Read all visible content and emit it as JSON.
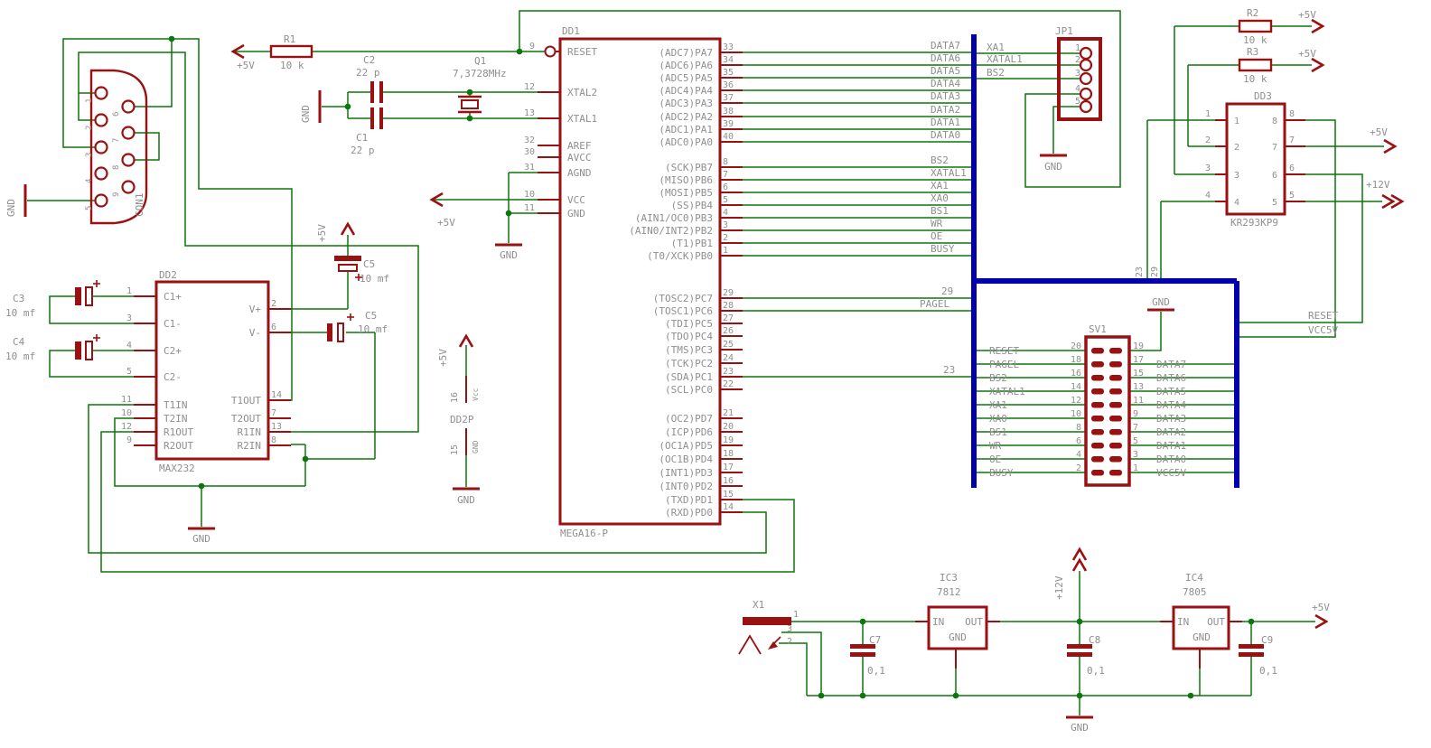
{
  "power": {
    "p5v": "+5V",
    "p12v": "+12V",
    "gnd": "GND"
  },
  "nets": {
    "reset": "RESET",
    "vcc5v": "VCC5V",
    "pagel": "PAGEL",
    "n23": "23",
    "n29": "29"
  },
  "components": {
    "con1": {
      "ref": "CON1",
      "pins_left": [
        "1",
        "2",
        "3",
        "4",
        "5"
      ],
      "pins_right": [
        "6",
        "7",
        "8",
        "9"
      ]
    },
    "r1": {
      "ref": "R1",
      "value": "10 k"
    },
    "r2": {
      "ref": "R2",
      "value": "10 k"
    },
    "r3": {
      "ref": "R3",
      "value": "10 k"
    },
    "c1": {
      "ref": "C1",
      "value": "22 p"
    },
    "c2": {
      "ref": "C2",
      "value": "22 p"
    },
    "c3": {
      "ref": "C3",
      "value": "10 mf"
    },
    "c4": {
      "ref": "C4",
      "value": "10 mf"
    },
    "c5a": {
      "ref": "C5",
      "value": "10 mf"
    },
    "c5b": {
      "ref": "C5",
      "value": "10 mf"
    },
    "c7": {
      "ref": "C7",
      "value": "0,1"
    },
    "c8": {
      "ref": "C8",
      "value": "0,1"
    },
    "c9": {
      "ref": "C9",
      "value": "0,1"
    },
    "q1": {
      "ref": "Q1",
      "value": "7,3728MHz"
    },
    "x1": {
      "ref": "X1",
      "pins": [
        "1",
        "3",
        "2"
      ]
    },
    "ic3": {
      "ref": "IC3",
      "value": "7812",
      "pin_in": "IN",
      "pin_out": "OUT",
      "pin_gnd": "GND"
    },
    "ic4": {
      "ref": "IC4",
      "value": "7805",
      "pin_in": "IN",
      "pin_out": "OUT",
      "pin_gnd": "GND"
    },
    "jp1": {
      "ref": "JP1",
      "pins": [
        "1",
        "2",
        "3",
        "4",
        "5"
      ],
      "nets": [
        "XA1",
        "XATAL1",
        "BS2"
      ]
    },
    "dd3": {
      "ref": "DD3",
      "value": "KR293KP9",
      "left_pins": [
        "1",
        "2",
        "3",
        "4"
      ],
      "right_pins": [
        "8",
        "7",
        "6",
        "5"
      ]
    },
    "dd2p": {
      "ref": "DD2P",
      "vcc_num": "16",
      "vcc_name": "Vcc",
      "gnd_num": "15",
      "gnd_name": "GND"
    },
    "dd2": {
      "ref": "DD2",
      "value": "MAX232",
      "left": [
        {
          "n": "1",
          "name": "C1+"
        },
        {
          "n": "3",
          "name": "C1-"
        },
        {
          "n": "4",
          "name": "C2+"
        },
        {
          "n": "5",
          "name": "C2-"
        },
        {
          "n": "11",
          "name": "T1IN"
        },
        {
          "n": "10",
          "name": "T2IN"
        },
        {
          "n": "12",
          "name": "R1OUT"
        },
        {
          "n": "9",
          "name": "R2OUT"
        }
      ],
      "right": [
        {
          "n": "2",
          "name": "V+"
        },
        {
          "n": "6",
          "name": "V-"
        },
        {
          "n": "14",
          "name": "T1OUT"
        },
        {
          "n": "7",
          "name": "T2OUT"
        },
        {
          "n": "13",
          "name": "R1IN"
        },
        {
          "n": "8",
          "name": "R2IN"
        }
      ]
    },
    "dd1": {
      "ref": "DD1",
      "value": "MEGA16-P",
      "left": [
        {
          "n": "9",
          "name": "RESET"
        },
        {
          "n": "12",
          "name": "XTAL2"
        },
        {
          "n": "13",
          "name": "XTAL1"
        },
        {
          "n": "32",
          "name": "AREF"
        },
        {
          "n": "30",
          "name": "AVCC"
        },
        {
          "n": "31",
          "name": "AGND"
        },
        {
          "n": "10",
          "name": "VCC"
        },
        {
          "n": "11",
          "name": "GND"
        }
      ],
      "pa": [
        {
          "n": "33",
          "name": "(ADC7)PA7",
          "net": "DATA7"
        },
        {
          "n": "34",
          "name": "(ADC6)PA6",
          "net": "DATA6"
        },
        {
          "n": "35",
          "name": "(ADC5)PA5",
          "net": "DATA5"
        },
        {
          "n": "36",
          "name": "(ADC4)PA4",
          "net": "DATA4"
        },
        {
          "n": "37",
          "name": "(ADC3)PA3",
          "net": "DATA3"
        },
        {
          "n": "38",
          "name": "(ADC2)PA2",
          "net": "DATA2"
        },
        {
          "n": "39",
          "name": "(ADC1)PA1",
          "net": "DATA1"
        },
        {
          "n": "40",
          "name": "(ADC0)PA0",
          "net": "DATA0"
        }
      ],
      "pb": [
        {
          "n": "8",
          "name": "(SCK)PB7",
          "net": "BS2"
        },
        {
          "n": "7",
          "name": "(MISO)PB6",
          "net": "XATAL1"
        },
        {
          "n": "6",
          "name": "(MOSI)PB5",
          "net": "XA1"
        },
        {
          "n": "5",
          "name": "(SS)PB4",
          "net": "XA0"
        },
        {
          "n": "4",
          "name": "(AIN1/OC0)PB3",
          "net": "BS1"
        },
        {
          "n": "3",
          "name": "(AIN0/INT2)PB2",
          "net": "WR"
        },
        {
          "n": "2",
          "name": "(T1)PB1",
          "net": "OE"
        },
        {
          "n": "1",
          "name": "(T0/XCK)PB0",
          "net": "BUSY"
        }
      ],
      "pc": [
        {
          "n": "29",
          "name": "(TOSC2)PC7",
          "net": "29"
        },
        {
          "n": "28",
          "name": "(TOSC1)PC6",
          "net": "PAGEL"
        },
        {
          "n": "27",
          "name": "(TDI)PC5",
          "net": null
        },
        {
          "n": "26",
          "name": "(TDO)PC4",
          "net": null
        },
        {
          "n": "25",
          "name": "(TMS)PC3",
          "net": null
        },
        {
          "n": "24",
          "name": "(TCK)PC2",
          "net": null
        },
        {
          "n": "23",
          "name": "(SDA)PC1",
          "net": "23"
        },
        {
          "n": "22",
          "name": "(SCL)PC0",
          "net": null
        }
      ],
      "pd": [
        {
          "n": "21",
          "name": "(OC2)PD7"
        },
        {
          "n": "20",
          "name": "(ICP)PD6"
        },
        {
          "n": "19",
          "name": "(OC1A)PD5"
        },
        {
          "n": "18",
          "name": "(OC1B)PD4"
        },
        {
          "n": "17",
          "name": "(INT1)PD3"
        },
        {
          "n": "16",
          "name": "(INT0)PD2"
        },
        {
          "n": "15",
          "name": "(TXD)PD1"
        },
        {
          "n": "14",
          "name": "(RXD)PD0"
        }
      ]
    },
    "sv1": {
      "ref": "SV1",
      "rows": [
        {
          "lnet": "RESET",
          "lpin": "20",
          "rpin": "19",
          "rnet": null
        },
        {
          "lnet": "PAGEL",
          "lpin": "18",
          "rpin": "17",
          "rnet": "DATA7"
        },
        {
          "lnet": "BS2",
          "lpin": "16",
          "rpin": "15",
          "rnet": "DATA6"
        },
        {
          "lnet": "XATAL1",
          "lpin": "14",
          "rpin": "13",
          "rnet": "DATA5"
        },
        {
          "lnet": "XA1",
          "lpin": "12",
          "rpin": "11",
          "rnet": "DATA4"
        },
        {
          "lnet": "XA0",
          "lpin": "10",
          "rpin": "9",
          "rnet": "DATA3"
        },
        {
          "lnet": "BS1",
          "lpin": "8",
          "rpin": "7",
          "rnet": "DATA2"
        },
        {
          "lnet": "WR",
          "lpin": "6",
          "rpin": "5",
          "rnet": "DATA1"
        },
        {
          "lnet": "OE",
          "lpin": "4",
          "rpin": "3",
          "rnet": "DATA0"
        },
        {
          "lnet": "BUSY",
          "lpin": "2",
          "rpin": "1",
          "rnet": "VCC5V"
        }
      ]
    }
  }
}
